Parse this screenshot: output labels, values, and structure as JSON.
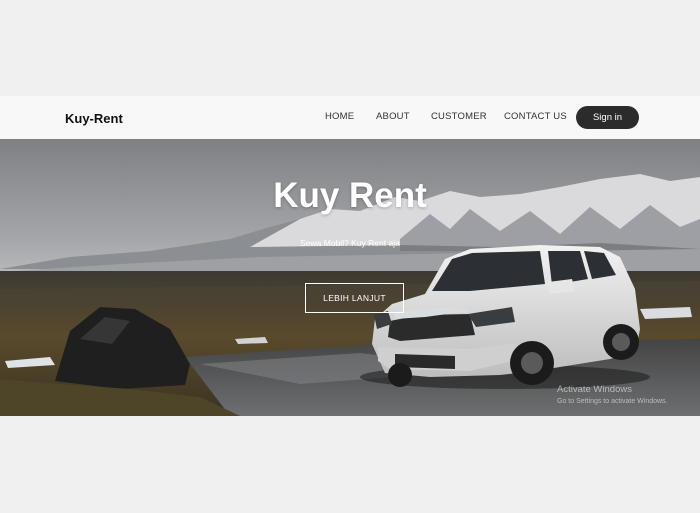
{
  "brand": "Kuy-Rent",
  "nav": {
    "home": "HOME",
    "about": "ABOUT",
    "customer": "CUSTOMER",
    "contact": "CONTACT US",
    "signin": "Sign in"
  },
  "hero": {
    "title": "Kuy Rent",
    "subtitle": "Sewa Mobil? Kuy Rent aja",
    "button": "LEBIH LANJUT"
  },
  "watermark": {
    "title": "Activate Windows",
    "subtitle": "Go to Settings to activate Windows."
  },
  "colors": {
    "navbar_bg": "#f8f8f8",
    "signin_bg": "#2b2b2b",
    "page_bg": "#f0f0f0"
  }
}
